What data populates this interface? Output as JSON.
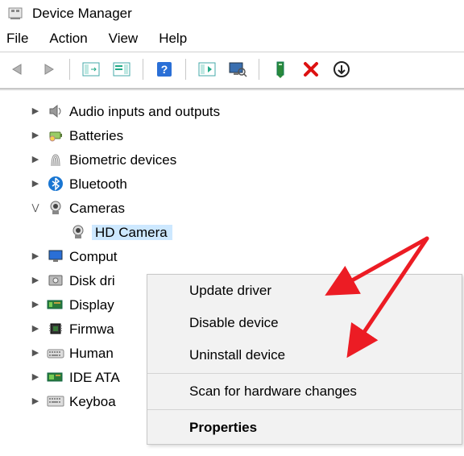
{
  "window": {
    "title": "Device Manager"
  },
  "menubar": {
    "file": "File",
    "action": "Action",
    "view": "View",
    "help": "Help"
  },
  "toolbar_icons": {
    "back": "back-arrow",
    "forward": "forward-arrow",
    "show_hidden": "panel-left",
    "properties": "panel-prop",
    "help": "help",
    "scan": "scan",
    "monitor_search": "monitor-search",
    "update": "update-driver",
    "delete": "delete",
    "eject": "eject"
  },
  "tree": {
    "items": [
      {
        "label": "Audio inputs and outputs",
        "icon": "speaker",
        "expanded": false
      },
      {
        "label": "Batteries",
        "icon": "battery",
        "expanded": false
      },
      {
        "label": "Biometric devices",
        "icon": "fingerprint",
        "expanded": false
      },
      {
        "label": "Bluetooth",
        "icon": "bluetooth",
        "expanded": false
      },
      {
        "label": "Cameras",
        "icon": "camera",
        "expanded": true,
        "children": [
          {
            "label": "HD Camera",
            "icon": "camera",
            "selected": true
          }
        ]
      },
      {
        "label": "Comput",
        "icon": "monitor",
        "expanded": false,
        "truncated": true
      },
      {
        "label": "Disk dri",
        "icon": "disk",
        "expanded": false,
        "truncated": true
      },
      {
        "label": "Display",
        "icon": "display-adapter",
        "expanded": false,
        "truncated": true
      },
      {
        "label": "Firmwa",
        "icon": "chip",
        "expanded": false,
        "truncated": true
      },
      {
        "label": "Human",
        "icon": "hid",
        "expanded": false,
        "truncated": true
      },
      {
        "label": "IDE ATA",
        "icon": "ide",
        "expanded": false,
        "truncated": true
      },
      {
        "label": "Keyboa",
        "icon": "keyboard",
        "expanded": false,
        "truncated": true
      }
    ]
  },
  "context_menu": {
    "items": [
      {
        "label": "Update driver"
      },
      {
        "label": "Disable device"
      },
      {
        "label": "Uninstall device"
      },
      {
        "sep": true
      },
      {
        "label": "Scan for hardware changes"
      },
      {
        "sep": true
      },
      {
        "label": "Properties",
        "bold": true
      }
    ]
  }
}
